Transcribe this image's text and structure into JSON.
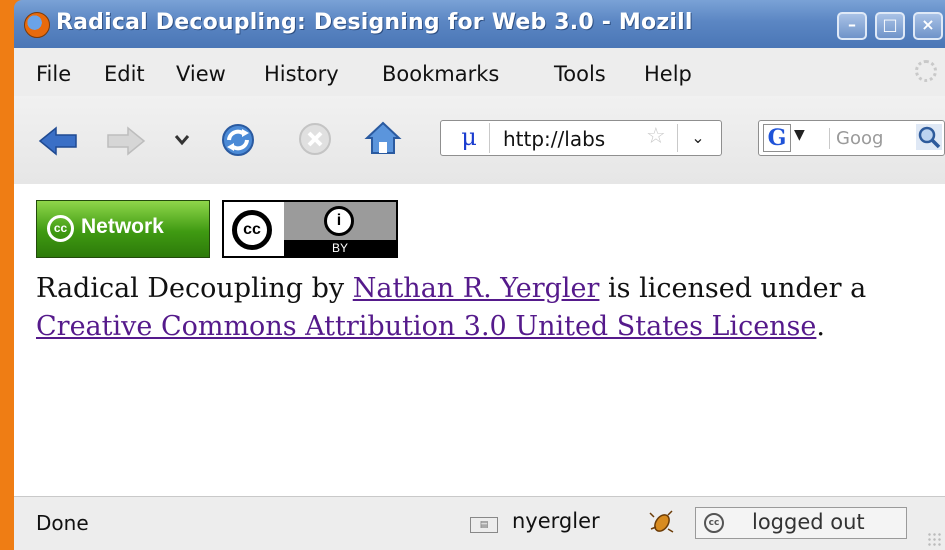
{
  "window": {
    "title": "Radical Decoupling: Designing for Web 3.0 - Mozill",
    "buttons": [
      "minimize",
      "maximize",
      "close"
    ]
  },
  "menu": {
    "items": [
      "File",
      "Edit",
      "View",
      "History",
      "Bookmarks",
      "Tools",
      "Help"
    ]
  },
  "toolbar": {
    "url": "http://labs",
    "favicon_glyph": "μ",
    "search_engine_glyph": "G",
    "search_placeholder": "Goog"
  },
  "content": {
    "badge_network_label": "Network",
    "badge_cc_glyph": "cc",
    "badge_by_label": "BY",
    "license_text_1": "Radical Decoupling by ",
    "author_link": "Nathan R. Yergler",
    "license_text_2": " is licensed under a ",
    "license_link": "Creative Commons Attribution 3.0 United States License",
    "license_text_3": "."
  },
  "status": {
    "text": "Done",
    "user": "nyergler",
    "login_state": "logged out"
  },
  "colors": {
    "titlebar": "#5b86c3",
    "desktop": "#ef7d14",
    "link": "#551a8b"
  }
}
